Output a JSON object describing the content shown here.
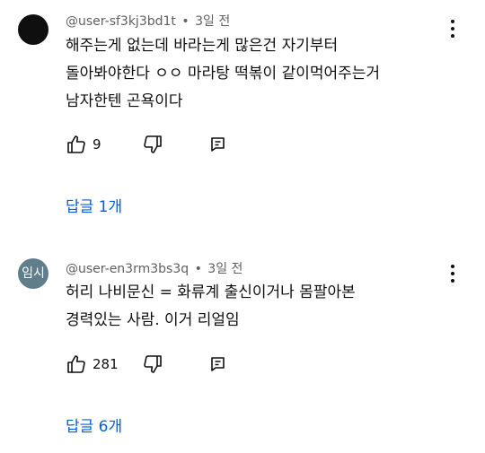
{
  "comments": [
    {
      "author": "@user-sf3kj3bd1t",
      "time": "3일 전",
      "lines": [
        "해주는게 없는데 바라는게 많은건 자기부터",
        "돌아봐야한다 ㅇㅇ 마라탕 떡볶이 같이먹어주는거",
        "남자한텐 곤욕이다"
      ],
      "likes": "9",
      "replies": "답글 1개",
      "avatar_color": "#0f0f0f"
    },
    {
      "author": "@user-en3rm3bs3q",
      "time": "3일 전",
      "avatar_text": "임시",
      "lines": [
        "허리 나비문신 = 화류계 출신이거나 몸팔아본",
        "경력있는 사람. 이거 리얼임"
      ],
      "likes": "281",
      "replies": "답글 6개",
      "avatar_color": "#607d8b"
    }
  ],
  "meta_separator": "•",
  "colors": {
    "link": "#065fd4",
    "meta": "#606060",
    "text": "#0f0f0f"
  },
  "icons": [
    "like-icon",
    "dislike-icon",
    "reply-icon",
    "more-options-icon"
  ]
}
